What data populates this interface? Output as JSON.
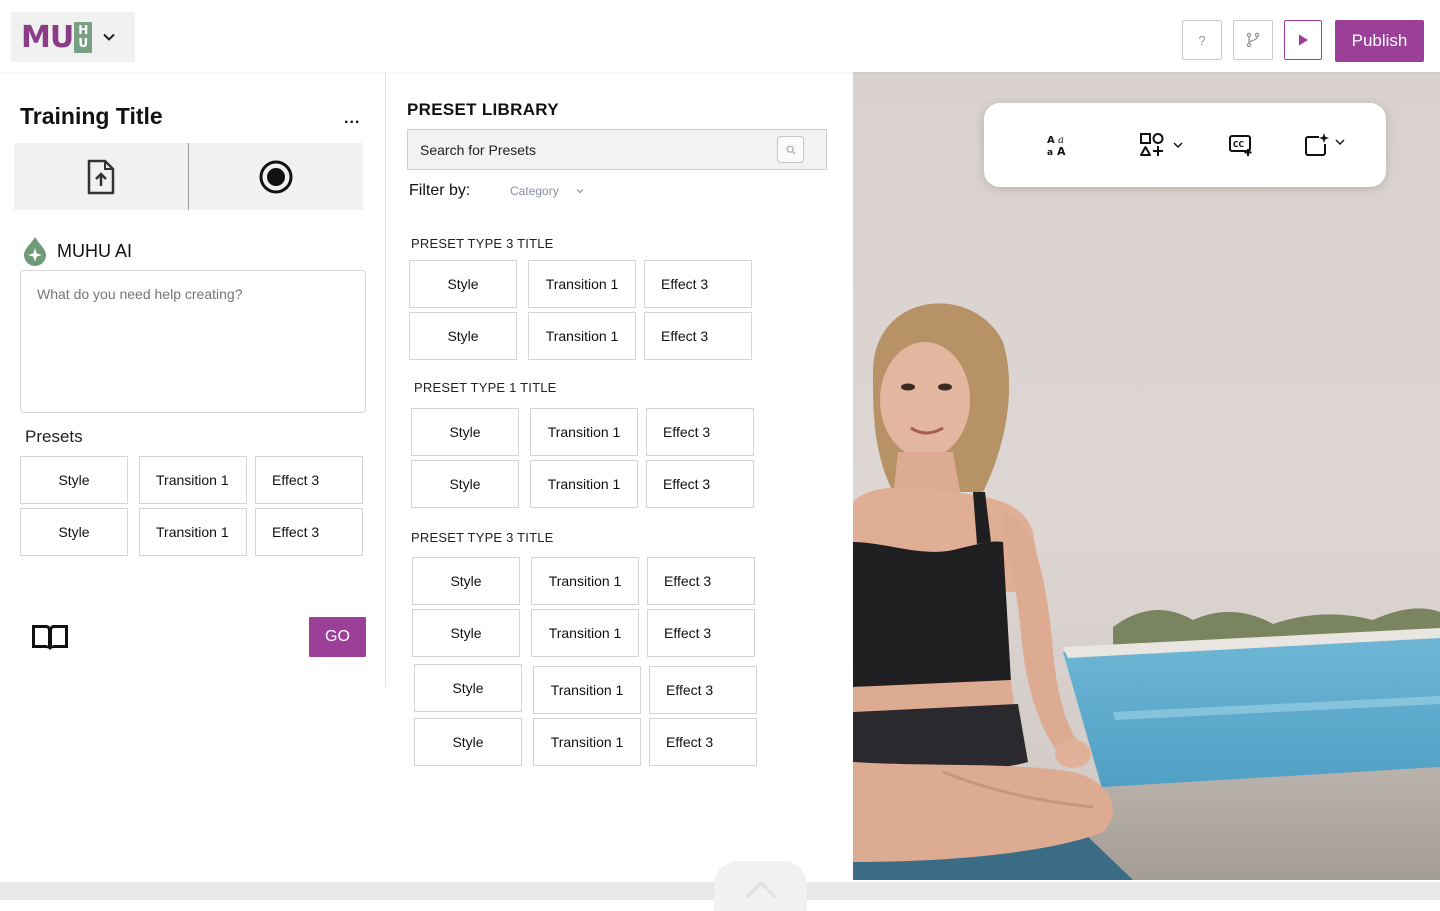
{
  "app": {
    "logo_text": "MU",
    "logo_hu_top": "H",
    "logo_hu_bottom": "U",
    "brand_color": "#9c3f98"
  },
  "topbar": {
    "help_label": "?",
    "publish_label": "Publish"
  },
  "left_panel": {
    "title": "Training Title",
    "more_label": "...",
    "ai_label": "MUHU AI",
    "prompt_placeholder": "What do you need help creating?",
    "presets_label": "Presets",
    "presets": [
      "Style",
      "Transition 1",
      "Effect 3",
      "Style",
      "Transition 1",
      "Effect 3"
    ],
    "go_label": "GO"
  },
  "library": {
    "title": "PRESET LIBRARY",
    "search_placeholder": "Search for Presets",
    "filter_label": "Filter by:",
    "filter_value": "Category",
    "sections": [
      {
        "title": "PRESET TYPE 3 TITLE",
        "items": [
          "Style",
          "Transition 1",
          "Effect 3",
          "Style",
          "Transition 1",
          "Effect 3"
        ]
      },
      {
        "title": "PRESET TYPE 1 TITLE",
        "items": [
          "Style",
          "Transition 1",
          "Effect 3",
          "Style",
          "Transition 1",
          "Effect 3"
        ]
      },
      {
        "title": "PRESET TYPE 3 TITLE",
        "items": [
          "Style",
          "Transition 1",
          "Effect 3",
          "Style",
          "Transition 1",
          "Effect 3",
          "Style",
          "Transition 1",
          "Effect 3",
          "Style",
          "Transition 1",
          "Effect 3"
        ]
      }
    ]
  },
  "canvas_toolbar": {
    "tools": [
      "translate-icon",
      "add-shapes-icon",
      "captions-icon",
      "ai-frame-icon"
    ]
  }
}
